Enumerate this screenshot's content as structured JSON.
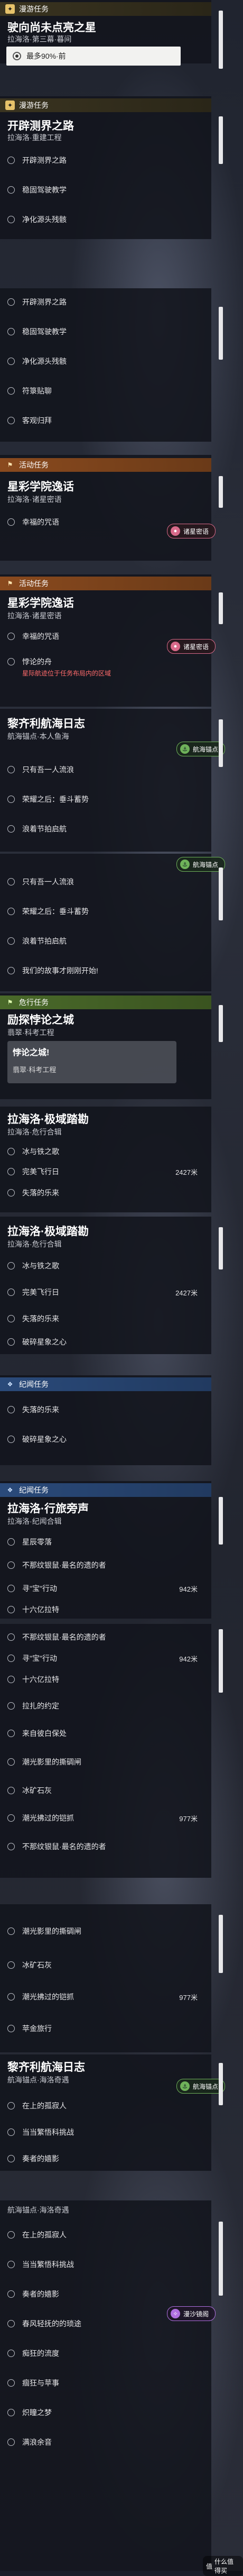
{
  "sections": {
    "s1": {
      "header": "漫游任务",
      "title": "驶向尚未点亮之星",
      "sub": "拉海洛·第三幕·暮间",
      "selected": "最多90%·前"
    },
    "s2": {
      "header": "漫游任务",
      "title": "开辟测界之路",
      "sub": "拉海洛·重建工程",
      "items": [
        "开辟测界之路",
        "稳固驾驶教学",
        "净化源头残骸"
      ]
    },
    "s3": {
      "items": [
        "开辟测界之路",
        "稳固驾驶教学",
        "净化源头残骸",
        "符箓贴聊",
        "客观归拜"
      ]
    },
    "s4": {
      "header": "活动任务",
      "title": "星彩学院逸话",
      "sub": "拉海洛·诸星密语",
      "items": [
        "幸福的咒语"
      ],
      "badge": "诸星密语"
    },
    "s5": {
      "header": "活动任务",
      "title": "星彩学院逸话",
      "sub": "拉海洛·诸星密语",
      "items": [
        "幸福的咒语",
        "悖论的舟"
      ],
      "red": "星际航迹位于任务布局内的区域",
      "badge": "诸星密语"
    },
    "s6": {
      "title": "黎齐利航海日志",
      "sub": "航海锚点·本人鱼海",
      "badge": "航海锚点",
      "items": [
        "只有吾一人流浪",
        "荣耀之后：垂斗蓄势",
        "浪着节拍启航"
      ]
    },
    "s7": {
      "items": [
        "只有吾一人流浪",
        "荣耀之后：垂斗蓄势",
        "浪着节拍启航",
        "我们的故事才刚刚开始!"
      ],
      "badge": "航海锚点"
    },
    "s8": {
      "header": "危行任务",
      "title": "励探悖论之城",
      "sub": "翡翠·科考工程",
      "popup": "悖论之城!",
      "sub2": "翡翠·科考工程"
    },
    "s9": {
      "title": "拉海洛·极域踏勘",
      "sub": "拉海洛·危行合辑",
      "items": [
        "冰与铁之歌",
        "完美飞行日",
        "失落的乐来",
        "破碎星象之心"
      ],
      "dist": "2427米"
    },
    "s10": {
      "title": "拉海洛·极域踏勘",
      "sub": "拉海洛·危行合辑",
      "items": [
        "冰与铁之歌",
        "完美飞行日",
        "失落的乐来",
        "破碎星象之心"
      ],
      "dist": "2427米"
    },
    "s11": {
      "header": "纪闻任务",
      "items": [
        "失落的乐来",
        "破碎星象之心"
      ]
    },
    "s12": {
      "header": "纪闻任务",
      "title": "拉海洛·行旅旁声",
      "sub": "拉海洛·纪闻合辑",
      "items": [
        "星辰零落",
        "不那纹银鼠·最名的遗的者",
        "寻\"宝\"行动",
        "十六亿拉特"
      ],
      "dist": "942米"
    },
    "s13": {
      "items": [
        "不那纹银鼠·最名的遗的者",
        "寻\"宝\"行动",
        "十六亿拉特",
        "拉扎的约定",
        "来自彼白保处",
        "潮光影里的撕碉闸",
        "冰矿石灰",
        "潮光拂过的铠抓",
        "不那纹银鼠·最名的遗的者"
      ],
      "dist1": "942米",
      "dist2": "977米"
    },
    "s14": {
      "items": [
        "潮光影里的撕碉闸",
        "冰矿石灰",
        "潮光拂过的铠抓",
        "苹金旅行"
      ],
      "dist": "977米"
    },
    "s15": {
      "title": "黎齐利航海日志",
      "sub": "航海锚点·海洛奇遇",
      "badge": "航海锚点",
      "items": [
        "在上的孤寂人",
        "当当繁悟科挑战",
        "奏者的嬉影"
      ]
    },
    "s16": {
      "header": "航海锚点·海洛奇遇",
      "items": [
        "在上的孤寂人",
        "当当繁悟科挑战",
        "奏者的嬉影",
        "春风轻抚的的琐途",
        "痴狂的流度",
        "痼狂与苹事",
        "炽瞳之梦",
        "满浪余音"
      ],
      "badge": "漫沙镜阁"
    }
  },
  "watermark": "什么值得买"
}
